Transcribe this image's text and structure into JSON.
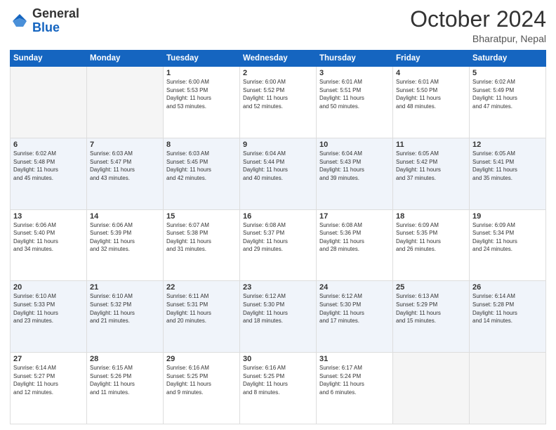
{
  "header": {
    "logo": {
      "general": "General",
      "blue": "Blue"
    },
    "title": "October 2024",
    "subtitle": "Bharatpur, Nepal"
  },
  "weekdays": [
    "Sunday",
    "Monday",
    "Tuesday",
    "Wednesday",
    "Thursday",
    "Friday",
    "Saturday"
  ],
  "weeks": [
    [
      {
        "day": "",
        "info": ""
      },
      {
        "day": "",
        "info": ""
      },
      {
        "day": "1",
        "info": "Sunrise: 6:00 AM\nSunset: 5:53 PM\nDaylight: 11 hours\nand 53 minutes."
      },
      {
        "day": "2",
        "info": "Sunrise: 6:00 AM\nSunset: 5:52 PM\nDaylight: 11 hours\nand 52 minutes."
      },
      {
        "day": "3",
        "info": "Sunrise: 6:01 AM\nSunset: 5:51 PM\nDaylight: 11 hours\nand 50 minutes."
      },
      {
        "day": "4",
        "info": "Sunrise: 6:01 AM\nSunset: 5:50 PM\nDaylight: 11 hours\nand 48 minutes."
      },
      {
        "day": "5",
        "info": "Sunrise: 6:02 AM\nSunset: 5:49 PM\nDaylight: 11 hours\nand 47 minutes."
      }
    ],
    [
      {
        "day": "6",
        "info": "Sunrise: 6:02 AM\nSunset: 5:48 PM\nDaylight: 11 hours\nand 45 minutes."
      },
      {
        "day": "7",
        "info": "Sunrise: 6:03 AM\nSunset: 5:47 PM\nDaylight: 11 hours\nand 43 minutes."
      },
      {
        "day": "8",
        "info": "Sunrise: 6:03 AM\nSunset: 5:45 PM\nDaylight: 11 hours\nand 42 minutes."
      },
      {
        "day": "9",
        "info": "Sunrise: 6:04 AM\nSunset: 5:44 PM\nDaylight: 11 hours\nand 40 minutes."
      },
      {
        "day": "10",
        "info": "Sunrise: 6:04 AM\nSunset: 5:43 PM\nDaylight: 11 hours\nand 39 minutes."
      },
      {
        "day": "11",
        "info": "Sunrise: 6:05 AM\nSunset: 5:42 PM\nDaylight: 11 hours\nand 37 minutes."
      },
      {
        "day": "12",
        "info": "Sunrise: 6:05 AM\nSunset: 5:41 PM\nDaylight: 11 hours\nand 35 minutes."
      }
    ],
    [
      {
        "day": "13",
        "info": "Sunrise: 6:06 AM\nSunset: 5:40 PM\nDaylight: 11 hours\nand 34 minutes."
      },
      {
        "day": "14",
        "info": "Sunrise: 6:06 AM\nSunset: 5:39 PM\nDaylight: 11 hours\nand 32 minutes."
      },
      {
        "day": "15",
        "info": "Sunrise: 6:07 AM\nSunset: 5:38 PM\nDaylight: 11 hours\nand 31 minutes."
      },
      {
        "day": "16",
        "info": "Sunrise: 6:08 AM\nSunset: 5:37 PM\nDaylight: 11 hours\nand 29 minutes."
      },
      {
        "day": "17",
        "info": "Sunrise: 6:08 AM\nSunset: 5:36 PM\nDaylight: 11 hours\nand 28 minutes."
      },
      {
        "day": "18",
        "info": "Sunrise: 6:09 AM\nSunset: 5:35 PM\nDaylight: 11 hours\nand 26 minutes."
      },
      {
        "day": "19",
        "info": "Sunrise: 6:09 AM\nSunset: 5:34 PM\nDaylight: 11 hours\nand 24 minutes."
      }
    ],
    [
      {
        "day": "20",
        "info": "Sunrise: 6:10 AM\nSunset: 5:33 PM\nDaylight: 11 hours\nand 23 minutes."
      },
      {
        "day": "21",
        "info": "Sunrise: 6:10 AM\nSunset: 5:32 PM\nDaylight: 11 hours\nand 21 minutes."
      },
      {
        "day": "22",
        "info": "Sunrise: 6:11 AM\nSunset: 5:31 PM\nDaylight: 11 hours\nand 20 minutes."
      },
      {
        "day": "23",
        "info": "Sunrise: 6:12 AM\nSunset: 5:30 PM\nDaylight: 11 hours\nand 18 minutes."
      },
      {
        "day": "24",
        "info": "Sunrise: 6:12 AM\nSunset: 5:30 PM\nDaylight: 11 hours\nand 17 minutes."
      },
      {
        "day": "25",
        "info": "Sunrise: 6:13 AM\nSunset: 5:29 PM\nDaylight: 11 hours\nand 15 minutes."
      },
      {
        "day": "26",
        "info": "Sunrise: 6:14 AM\nSunset: 5:28 PM\nDaylight: 11 hours\nand 14 minutes."
      }
    ],
    [
      {
        "day": "27",
        "info": "Sunrise: 6:14 AM\nSunset: 5:27 PM\nDaylight: 11 hours\nand 12 minutes."
      },
      {
        "day": "28",
        "info": "Sunrise: 6:15 AM\nSunset: 5:26 PM\nDaylight: 11 hours\nand 11 minutes."
      },
      {
        "day": "29",
        "info": "Sunrise: 6:16 AM\nSunset: 5:25 PM\nDaylight: 11 hours\nand 9 minutes."
      },
      {
        "day": "30",
        "info": "Sunrise: 6:16 AM\nSunset: 5:25 PM\nDaylight: 11 hours\nand 8 minutes."
      },
      {
        "day": "31",
        "info": "Sunrise: 6:17 AM\nSunset: 5:24 PM\nDaylight: 11 hours\nand 6 minutes."
      },
      {
        "day": "",
        "info": ""
      },
      {
        "day": "",
        "info": ""
      }
    ]
  ]
}
